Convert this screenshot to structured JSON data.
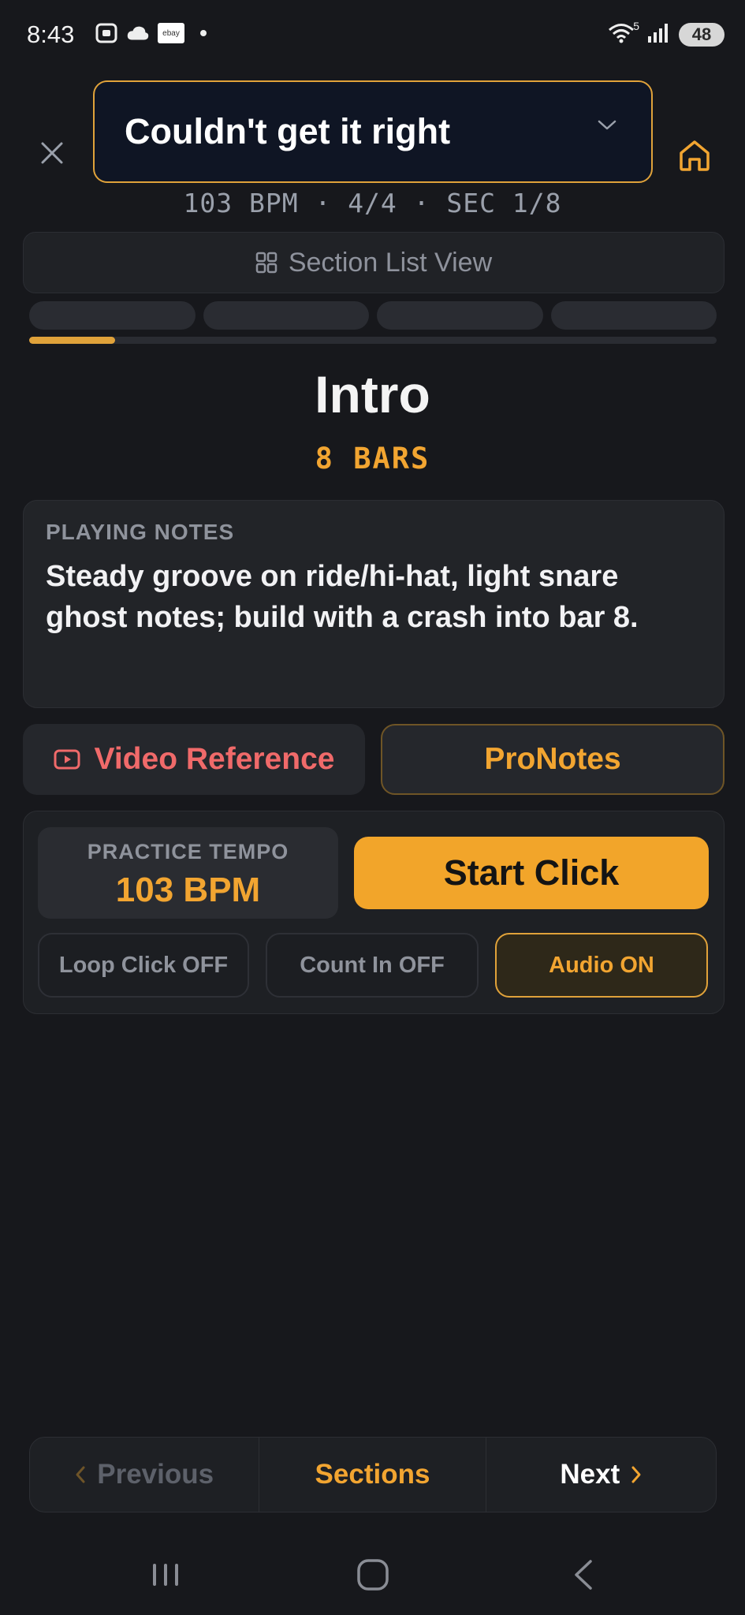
{
  "status_bar": {
    "time": "8:43",
    "wifi_badge": "5",
    "battery": "48",
    "ebay_label": "ebay"
  },
  "header": {
    "song_title": "Couldn't get it right",
    "meta": "103 BPM · 4/4 · SEC 1/8"
  },
  "section_list_button": "Section List View",
  "progress": {
    "current_section": 1,
    "total_sections": 8,
    "fraction": 0.125
  },
  "section": {
    "name": "Intro",
    "bars": "8 BARS"
  },
  "notes": {
    "heading": "PLAYING NOTES",
    "body": "Steady groove on ride/hi-hat, light snare ghost notes; build with a crash into bar 8."
  },
  "actions": {
    "video_reference": "Video Reference",
    "pronotes": "ProNotes"
  },
  "practice": {
    "tempo_label": "PRACTICE TEMPO",
    "tempo_value": "103 BPM",
    "start_click": "Start Click",
    "loop_click": "Loop Click OFF",
    "count_in": "Count In OFF",
    "audio": "Audio ON"
  },
  "bottom_nav": {
    "previous": "Previous",
    "sections": "Sections",
    "next": "Next"
  },
  "colors": {
    "accent": "#f2a531",
    "background": "#17181c",
    "video_red": "#f06a6a"
  }
}
